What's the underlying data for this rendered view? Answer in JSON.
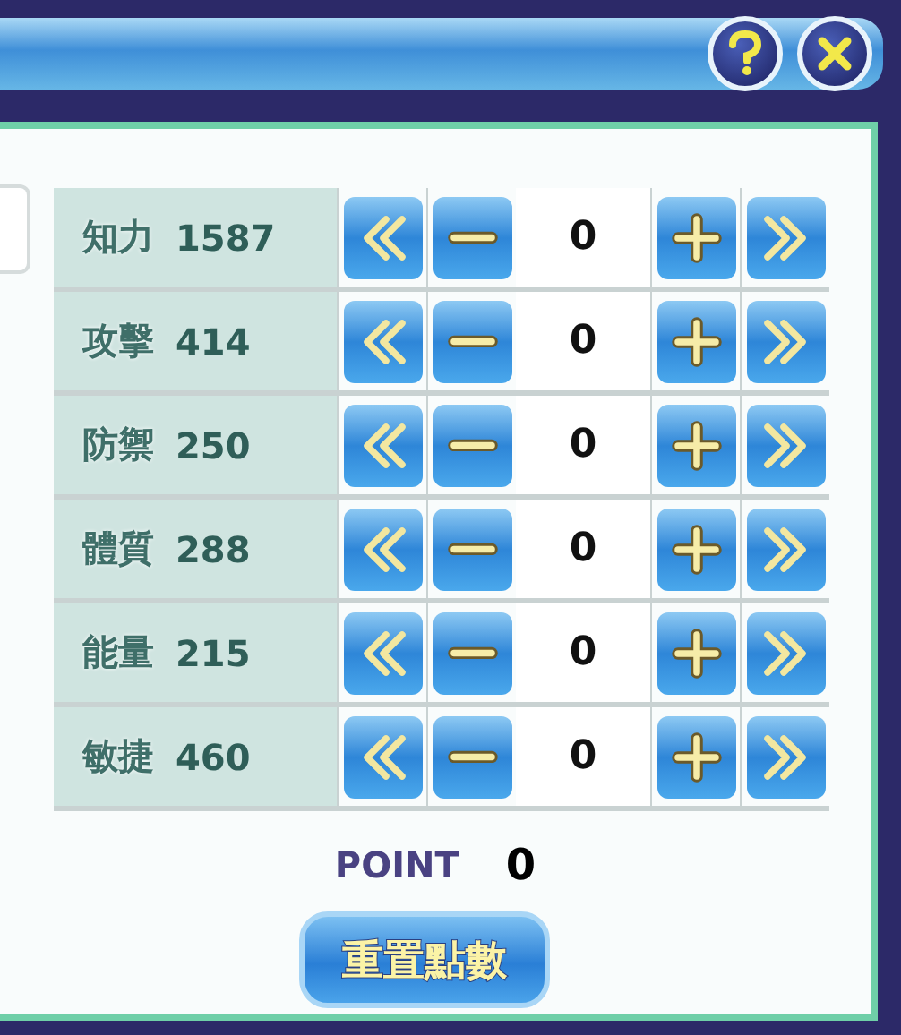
{
  "stats": [
    {
      "name": "知力",
      "value": "1587",
      "allocated": "0"
    },
    {
      "name": "攻擊",
      "value": "414",
      "allocated": "0"
    },
    {
      "name": "防禦",
      "value": "250",
      "allocated": "0"
    },
    {
      "name": "體質",
      "value": "288",
      "allocated": "0"
    },
    {
      "name": "能量",
      "value": "215",
      "allocated": "0"
    },
    {
      "name": "敏捷",
      "value": "460",
      "allocated": "0"
    }
  ],
  "points": {
    "label": "POINT",
    "value": "0"
  },
  "reset_button": "重置點數"
}
